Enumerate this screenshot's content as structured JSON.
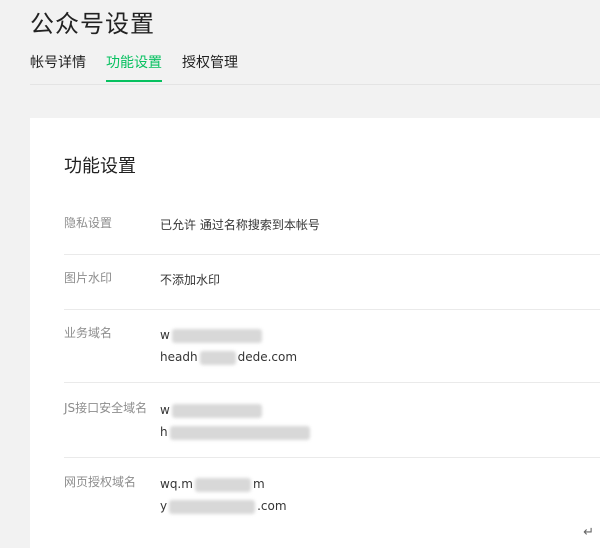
{
  "page": {
    "title": "公众号设置"
  },
  "tabs": [
    {
      "label": "帐号详情"
    },
    {
      "label": "功能设置"
    },
    {
      "label": "授权管理"
    }
  ],
  "section": {
    "title": "功能设置"
  },
  "rows": [
    {
      "label": "隐私设置",
      "values": [
        "已允许 通过名称搜索到本帐号"
      ]
    },
    {
      "label": "图片水印",
      "values": [
        "不添加水印"
      ]
    },
    {
      "label": "业务域名",
      "lines": [
        {
          "prefix": "w",
          "suffix": ""
        },
        {
          "prefix": "headh",
          "suffix": "dede.com"
        }
      ]
    },
    {
      "label": "JS接口安全域名",
      "lines": [
        {
          "prefix": "w",
          "suffix": ""
        },
        {
          "prefix": "h",
          "suffix": ""
        }
      ]
    },
    {
      "label": "网页授权域名",
      "lines": [
        {
          "prefix": "wq.m",
          "suffix": "m"
        },
        {
          "prefix": "y",
          "suffix": ".com"
        }
      ]
    }
  ],
  "icons": {
    "return": "return-arrow-icon"
  },
  "colors": {
    "accent": "#07c160"
  }
}
